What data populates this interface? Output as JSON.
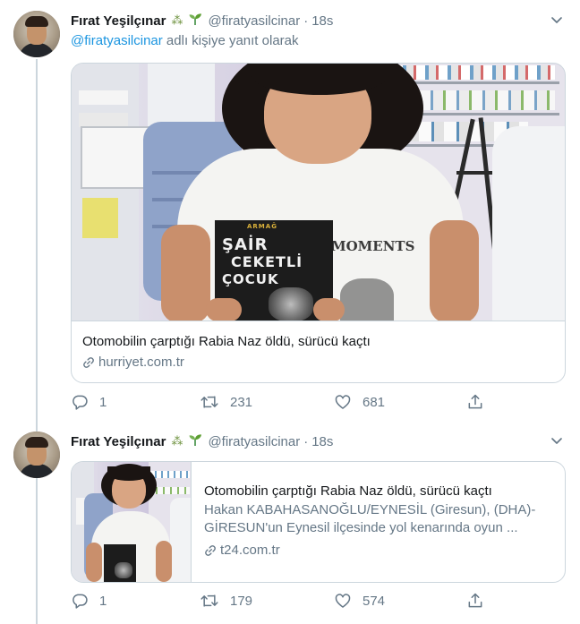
{
  "tweets": [
    {
      "author": {
        "display_name": "Fırat Yeşilçınar",
        "emoji_1": "⁂",
        "emoji_2": "🌱",
        "handle": "@firatyasilcinar",
        "separator": "·",
        "time": "18s"
      },
      "reply_to": {
        "mention": "@firatyasilcinar",
        "suffix": " adlı kişiye yanıt olarak"
      },
      "card": {
        "layout": "large",
        "title": "Otomobilin çarptığı Rabia Naz öldü, sürücü kaçtı",
        "domain": "hurriyet.com.tr",
        "image": {
          "book_title_line1": "ŞAİR",
          "book_title_line2": "CEKETLİ",
          "book_title_line3": "ÇOCUK",
          "book_top_label": "ARMAĞ",
          "shirt_text": "MOMENTS"
        }
      },
      "actions": {
        "reply_count": "1",
        "retweet_count": "231",
        "like_count": "681",
        "share_icon": "share-icon"
      }
    },
    {
      "author": {
        "display_name": "Fırat Yeşilçınar",
        "emoji_1": "⁂",
        "emoji_2": "🌱",
        "handle": "@firatyasilcinar",
        "separator": "·",
        "time": "18s"
      },
      "card": {
        "layout": "small",
        "title": "Otomobilin çarptığı Rabia Naz öldü, sürücü kaçtı",
        "description": "Hakan KABAHASANOĞLU/EYNESİL (Giresun), (DHA)-GİRESUN'un Eynesil ilçesinde yol kenarında oyun ...",
        "domain": "t24.com.tr"
      },
      "actions": {
        "reply_count": "1",
        "retweet_count": "179",
        "like_count": "574",
        "share_icon": "share-icon"
      }
    }
  ],
  "colors": {
    "text_primary": "#14171a",
    "text_secondary": "#657786",
    "link": "#1b95e0",
    "border": "#ccd6dd"
  }
}
